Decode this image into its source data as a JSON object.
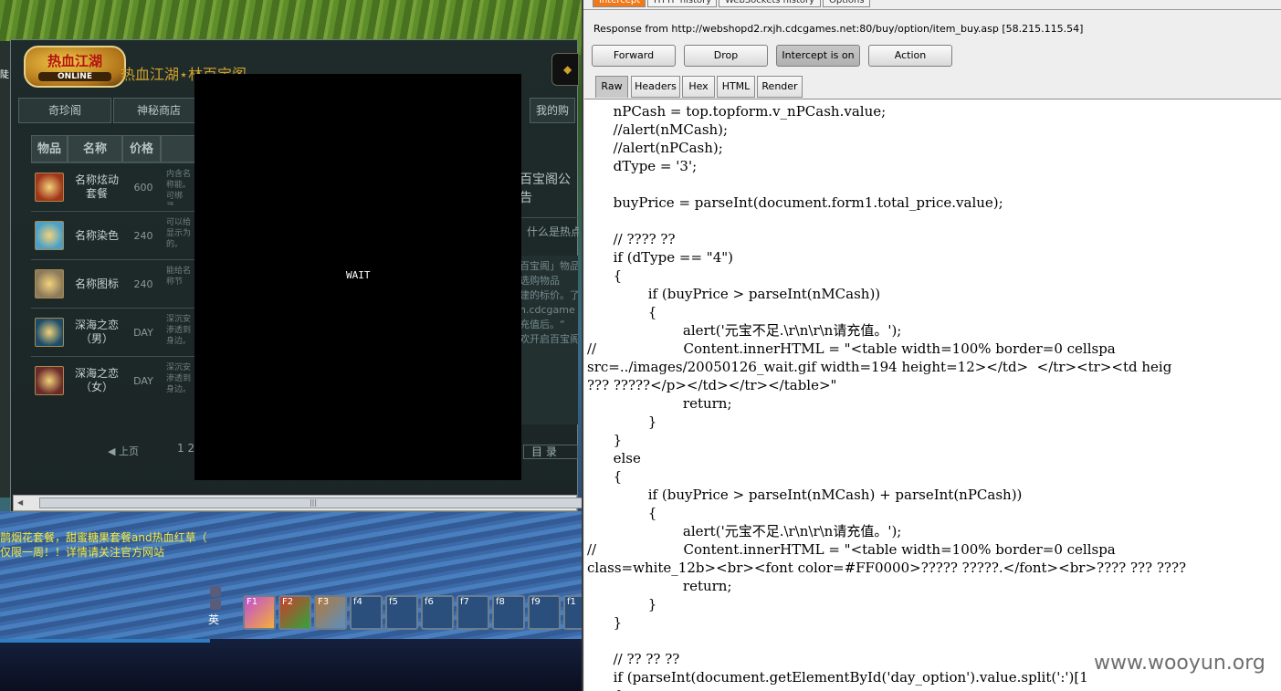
{
  "game": {
    "shop_logo": "热血江湖",
    "shop_logo_sub": "ONLINE",
    "shop_title": "热血江湖⋆林百宝阁",
    "tabs": [
      {
        "label": "奇珍阁"
      },
      {
        "label": "神秘商店"
      },
      {
        "label": "我的购"
      }
    ],
    "table_headers": [
      "物品",
      "名称",
      "价格"
    ],
    "items": [
      {
        "name": "名称炫动套餐",
        "price": "600",
        "desc": "内含名称能。可绑录。",
        "icon_color": "#a0341a"
      },
      {
        "name": "名称染色",
        "price": "240",
        "desc": "可以给显示为的。",
        "icon_color": "#4aa0c8"
      },
      {
        "name": "名称图标",
        "price": "240",
        "desc": "能给名称节",
        "icon_color": "#8d7a5c"
      },
      {
        "name": "深海之恋（男）",
        "price": "DAY",
        "desc": "深沉安渗透到身边。",
        "icon_color": "#1d4c6a"
      },
      {
        "name": "深海之恋（女）",
        "price": "DAY",
        "desc": "深沉安渗透到身边。",
        "icon_color": "#6a2a2a"
      }
    ],
    "pager_prev": "◀ 上页",
    "pager_num": "1 2",
    "notice_title": "百宝阁公告",
    "notice_question": "什么是热点",
    "notice_lines": [
      "百宝阁」物品",
      "选购物品",
      "建的标价。了",
      "h.cdcgame",
      "充值后。“",
      "欢开启百宝阁"
    ],
    "notice_dir": "目 录",
    "wait_text": "WAIT",
    "chat": [
      "鹊烟花套餐，甜蜜糖果套餐and热血红草（",
      "仅限一周！！详情请关注官方网站"
    ],
    "hotkeys": [
      "F1",
      "F2",
      "F3",
      "f4",
      "f5",
      "f6",
      "f7",
      "f8",
      "f9",
      "f1"
    ],
    "ime": "英",
    "left_edge_text": "陡"
  },
  "burp": {
    "tabs": [
      "Intercept",
      "HTTP history",
      "WebSockets history",
      "Options"
    ],
    "response_line": "Response from http://webshopd2.rxjh.cdcgames.net:80/buy/option/item_buy.asp  [58.215.115.54]",
    "buttons": {
      "forward": "Forward",
      "drop": "Drop",
      "intercept": "Intercept is on",
      "action": "Action"
    },
    "view_tabs": [
      "Raw",
      "Headers",
      "Hex",
      "HTML",
      "Render"
    ],
    "code_lines": [
      "      nPCash = top.topform.v_nPCash.value;",
      "      //alert(nMCash);",
      "      //alert(nPCash);",
      "      dType = '3';",
      "",
      "      buyPrice = parseInt(document.form1.total_price.value);",
      "",
      "      // ???? ??",
      "      if (dType == \"4\")",
      "      {",
      "              if (buyPrice > parseInt(nMCash))",
      "              {",
      "                      alert('元宝不足.\\r\\n\\r\\n请充值。');",
      "//                    Content.innerHTML = \"<table width=100% border=0 cellspa",
      "src=../images/20050126_wait.gif width=194 height=12></td>  </tr><tr><td heig",
      "??? ?????</p></td></tr></table>\"",
      "                      return;",
      "              }",
      "      }",
      "      else",
      "      {",
      "              if (buyPrice > parseInt(nMCash) + parseInt(nPCash))",
      "              {",
      "                      alert('元宝不足.\\r\\n\\r\\n请充值。');",
      "//                    Content.innerHTML = \"<table width=100% border=0 cellspa",
      "class=white_12b><br><font color=#FF0000>????? ?????.</font><br>???? ??? ????",
      "                      return;",
      "              }",
      "      }",
      "",
      "      // ?? ?? ??",
      "      if (parseInt(document.getElementById('day_option').value.split(':')[1",
      "      {"
    ],
    "watermark": "www.wooyun.org"
  }
}
